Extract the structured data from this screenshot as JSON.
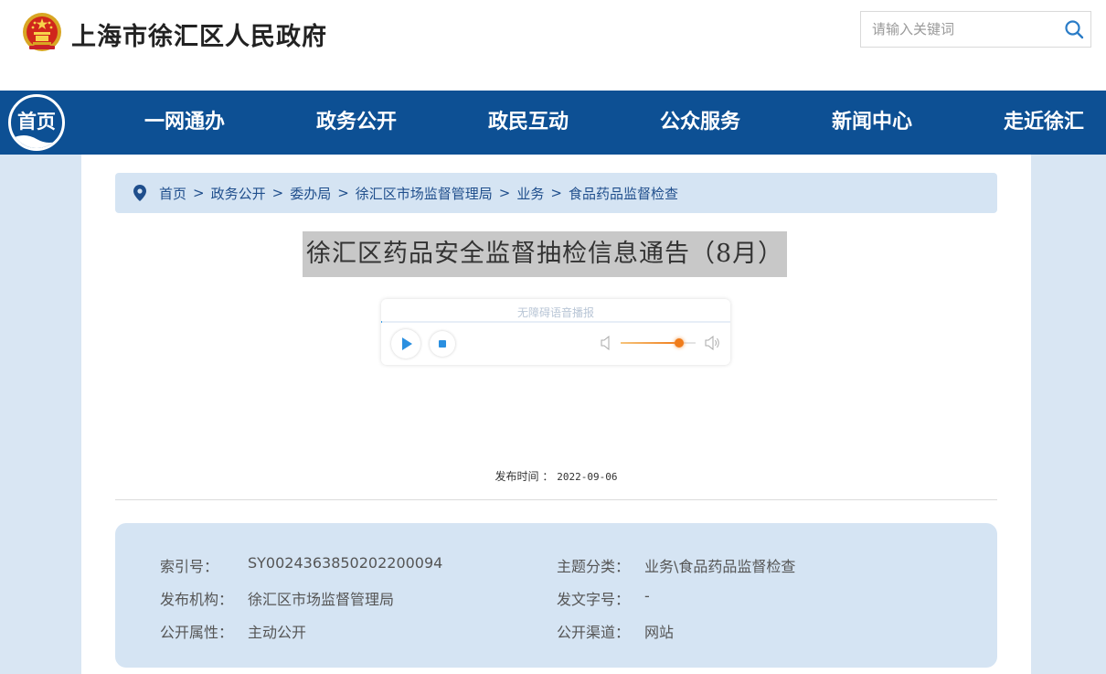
{
  "header": {
    "site_title": "上海市徐汇区人民政府",
    "search_placeholder": "请输入关键词"
  },
  "nav": {
    "home_label": "首页",
    "items": [
      "一网通办",
      "政务公开",
      "政民互动",
      "公众服务",
      "新闻中心",
      "走近徐汇"
    ],
    "bg_color": "#0d5094"
  },
  "breadcrumb": {
    "items": [
      "首页",
      "政务公开",
      "委办局",
      "徐汇区市场监督管理局",
      "业务",
      "食品药品监督检查"
    ],
    "separator": ">"
  },
  "article": {
    "title": "徐汇区药品安全监督抽检信息通告（8月）",
    "publish_label": "发布时间",
    "publish_sep": "：",
    "publish_date": "2022-09-06"
  },
  "player": {
    "title": "无障碍语音播报",
    "volume_fraction": 0.78
  },
  "meta": {
    "index_label": "索引号：",
    "index_value": "SY0024363850202200094",
    "topic_label": "主题分类：",
    "topic_value": "业务\\食品药品监督检查",
    "org_label": "发布机构：",
    "org_value": "徐汇区市场监督管理局",
    "docno_label": "发文字号：",
    "docno_value": "-",
    "attr_label": "公开属性：",
    "attr_value": "主动公开",
    "channel_label": "公开渠道：",
    "channel_value": "网站"
  }
}
